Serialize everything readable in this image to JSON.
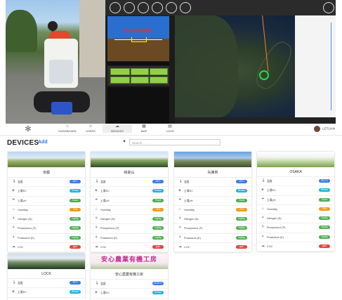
{
  "hero": {
    "hud_status": "DISARMED"
  },
  "nav": {
    "items": [
      {
        "label": "DASHBOARD",
        "icon": "dashboard-icon",
        "glyph": "⌂"
      },
      {
        "label": "USERS",
        "icon": "users-icon",
        "glyph": "☺"
      },
      {
        "label": "DEVICES",
        "icon": "devices-icon",
        "glyph": "☁"
      },
      {
        "label": "MAP",
        "icon": "map-icon",
        "glyph": "▦"
      },
      {
        "label": "LOGS",
        "icon": "logs-icon",
        "glyph": "▤"
      }
    ],
    "user_name": "LETUAN"
  },
  "devices": {
    "title": "DEVICES",
    "add_label": "Add",
    "filter_glyph": "▼",
    "search_placeholder": "Search..."
  },
  "metric_labels": [
    "温度",
    "土壌EC",
    "土壌pH",
    "Humidity",
    "Nitrogen (N)",
    "Phosphorus (P)",
    "Potassium (K)",
    "CO2"
  ],
  "cards": [
    {
      "name": "京都",
      "values": [
        "25°C",
        "Sensor",
        "Good",
        "75%",
        "mg/kg",
        "mg/kg",
        "mg/kg",
        "ppm"
      ]
    },
    {
      "name": "和歌山",
      "values": [
        "25°C",
        "Sensor",
        "Good",
        "75%",
        "mg/kg",
        "mg/kg",
        "mg/kg",
        "ppm"
      ]
    },
    {
      "name": "兵庫県",
      "values": [
        "25°C",
        "Sensor",
        "Good",
        "75%",
        "mg/kg",
        "mg/kg",
        "mg/kg",
        "ppm"
      ]
    },
    {
      "name": "OSAKA",
      "values": [
        "25.1°C",
        "Sensor",
        "Good",
        "75%",
        "mg/kg",
        "mg/kg",
        "mg/kg",
        "ppm"
      ]
    },
    {
      "name": "LOCK",
      "values": [
        "25°C",
        "Sensor"
      ]
    },
    {
      "name": "安心農業有機工房",
      "banner": "安心農業有機工房",
      "values": [
        "25.20°C",
        "Sensor"
      ]
    }
  ],
  "colors": {
    "badges": [
      "#3b7ddd",
      "#1fb5d8",
      "#4caf50",
      "#f29a17",
      "#4caf50",
      "#4caf50",
      "#4caf50",
      "#e8433a"
    ],
    "accent": "#2a7ae2"
  }
}
